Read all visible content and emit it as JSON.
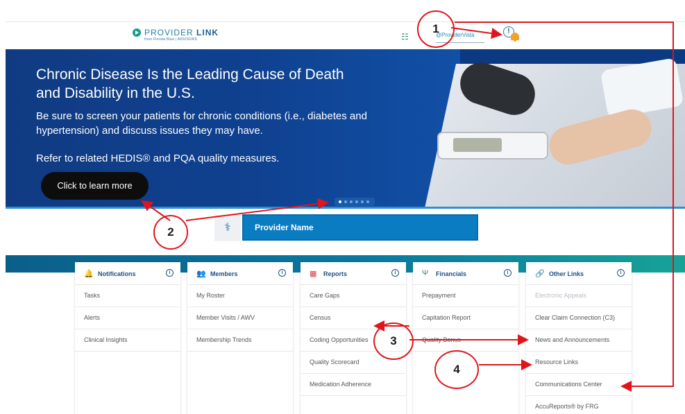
{
  "header": {
    "logo_text": "PROVIDER",
    "logo_text_bold": "LINK",
    "logo_sub": "from Florida Blue | ADVISORS",
    "provider_vista_label": "@ProviderVista",
    "info_icon": "info-icon",
    "bell_icon": "bell-icon",
    "colors": {
      "logo": "#1d7fa6",
      "bell": "#f2a327"
    }
  },
  "banner": {
    "title": "Chronic Disease Is the Leading Cause of Death and Disability in the U.S.",
    "line1": "Be sure to screen your patients for chronic conditions (i.e., diabetes and hypertension) and discuss issues they may have.",
    "line2": "Refer to related HEDIS® and PQA quality measures.",
    "cta_label": "Click to learn more",
    "carousel_dots": 6,
    "active_dot": 1,
    "colors": {
      "background": "#0f4190",
      "cta": "#0d0d0d"
    }
  },
  "provider": {
    "name": "Provider Name",
    "avatar_icon": "doctor-icon",
    "colors": {
      "bar": "#0a7cc2"
    }
  },
  "cards": [
    {
      "title": "Notifications",
      "icon": "bell-icon",
      "icon_color": "#1c4f86",
      "rows": [
        {
          "label": "Tasks",
          "disabled": false
        },
        {
          "label": "Alerts",
          "disabled": false
        },
        {
          "label": "Clinical Insights",
          "disabled": false
        }
      ]
    },
    {
      "title": "Members",
      "icon": "users-icon",
      "icon_color": "#1c4f86",
      "rows": [
        {
          "label": "My Roster",
          "disabled": false
        },
        {
          "label": "Member Visits / AWV",
          "disabled": false
        },
        {
          "label": "Membership Trends",
          "disabled": false
        }
      ]
    },
    {
      "title": "Reports",
      "icon": "report-icon",
      "icon_color": "#d63a3a",
      "rows": [
        {
          "label": "Care Gaps",
          "disabled": false
        },
        {
          "label": "Census",
          "disabled": false
        },
        {
          "label": "Coding Opportunities",
          "disabled": false
        },
        {
          "label": "Quality Scorecard",
          "disabled": false
        },
        {
          "label": "Medication Adherence",
          "disabled": false
        }
      ]
    },
    {
      "title": "Financials",
      "icon": "financials-icon",
      "icon_color": "#2e8b57",
      "rows": [
        {
          "label": "Prepayment",
          "disabled": false
        },
        {
          "label": "Capitation Report",
          "disabled": false
        },
        {
          "label": "Quality Bonus",
          "disabled": false
        }
      ]
    },
    {
      "title": "Other Links",
      "icon": "link-icon",
      "icon_color": "#1c4f86",
      "rows": [
        {
          "label": "Electronic Appeals",
          "disabled": true
        },
        {
          "label": "Clear Claim Connection (C3)",
          "disabled": false
        },
        {
          "label": "News and Announcements",
          "disabled": false
        },
        {
          "label": "Resource Links",
          "disabled": false
        },
        {
          "label": "Communications Center",
          "disabled": false
        },
        {
          "label": "AccuReports® by FRG",
          "disabled": false
        }
      ]
    }
  ],
  "annotations": {
    "labels": [
      "1",
      "2",
      "3",
      "4"
    ],
    "color": "#e0151b"
  }
}
